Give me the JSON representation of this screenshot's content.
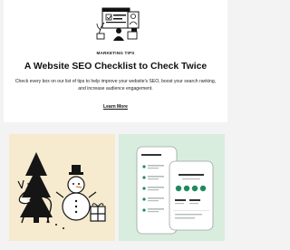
{
  "article": {
    "eyebrow": "MARKETING TIPS",
    "title": "A Website SEO Checklist to Check Twice",
    "description": "Check every box on our list of tips to help improve your website's SEO, boost your search ranking, and increase audience engagement.",
    "link_label": "Learn More"
  },
  "tiles": [
    {
      "illustration": "holiday-snowman-deer-illustration",
      "background": "#f6ebce"
    },
    {
      "illustration": "phone-app-mockup-illustration",
      "background": "#d8eddd"
    }
  ],
  "colors": {
    "accent_green": "#1f8a5b",
    "page_background": "#f3f3f3",
    "card": "#ffffff"
  }
}
